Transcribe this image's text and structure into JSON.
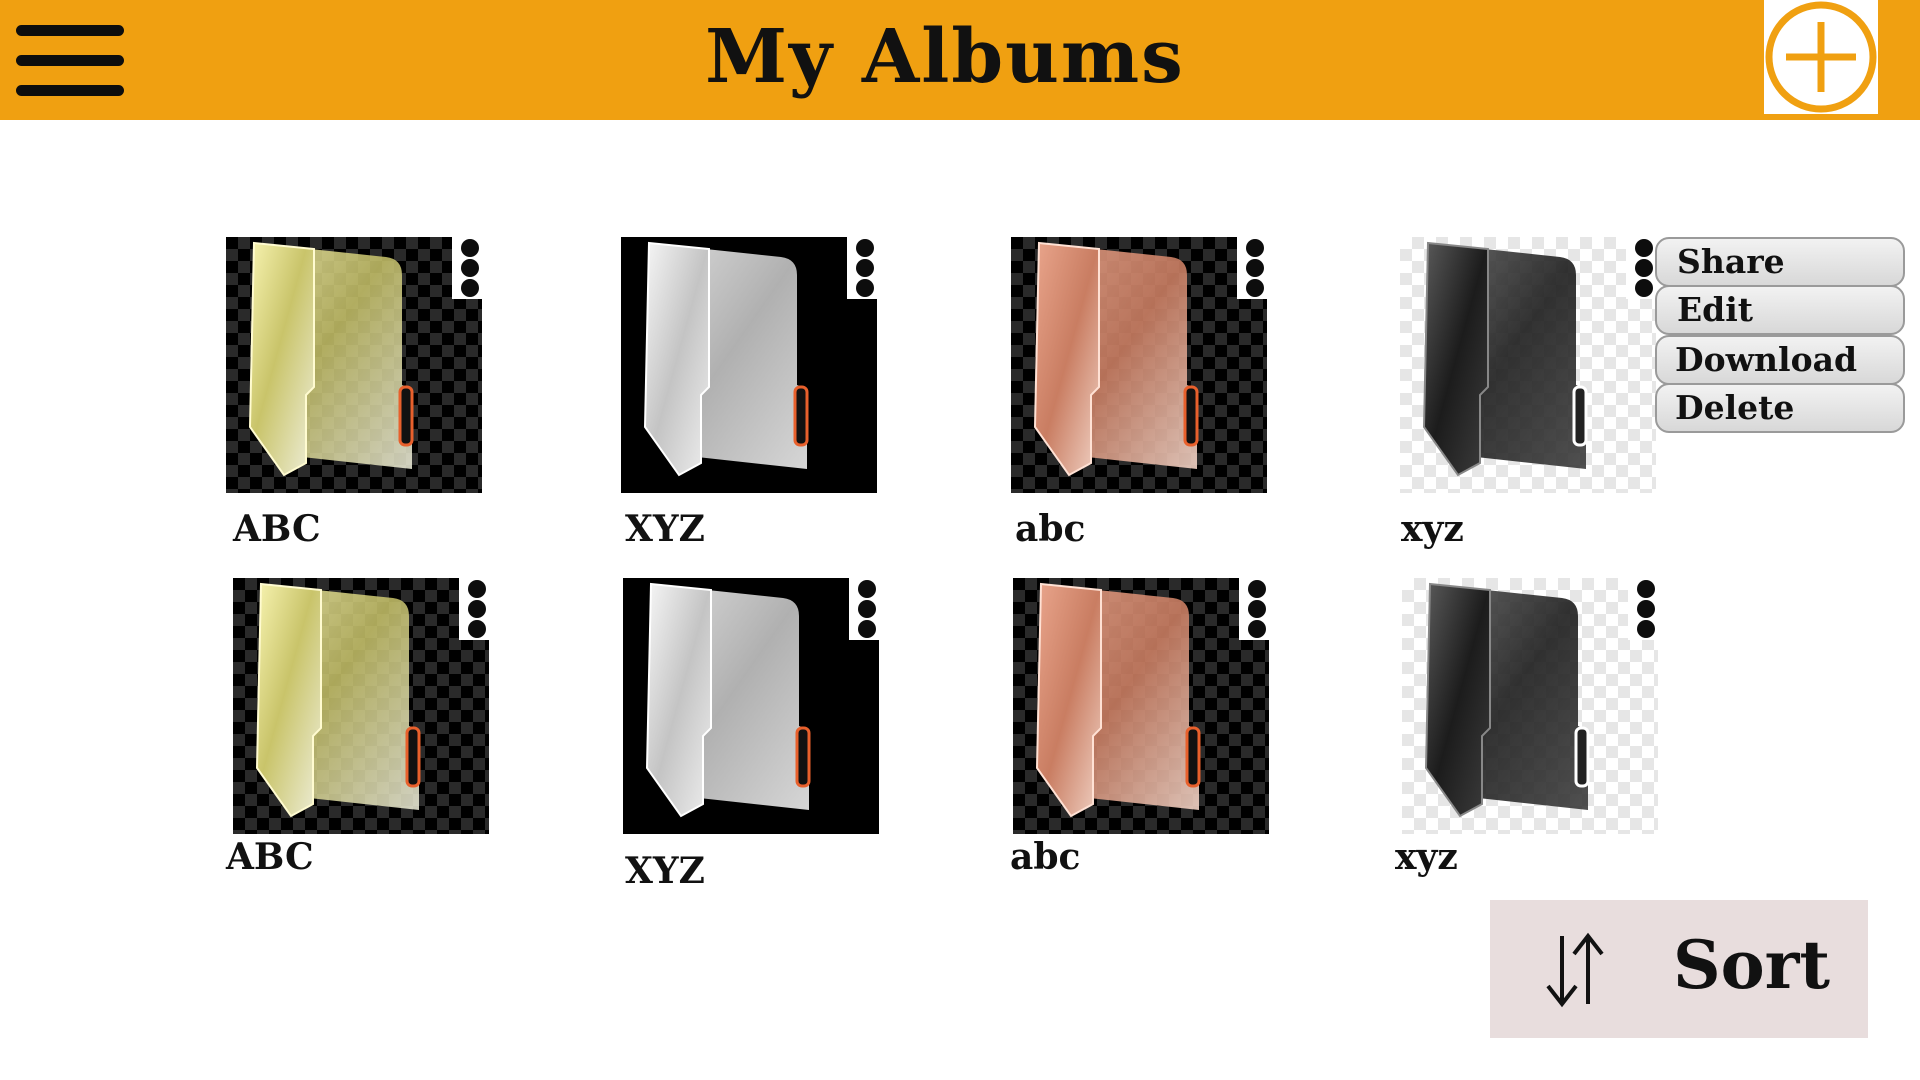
{
  "header": {
    "title": "My Albums",
    "background_color": "#f0a011",
    "menu_icon": "hamburger-menu-icon",
    "add_icon": "plus-circle-icon"
  },
  "albums": [
    {
      "label": "ABC",
      "folder_color": "yellow",
      "background": "checkerboard-dark"
    },
    {
      "label": "XYZ",
      "folder_color": "white",
      "background": "black"
    },
    {
      "label": "abc",
      "folder_color": "peach",
      "background": "checkerboard-dark"
    },
    {
      "label": "xyz",
      "folder_color": "black",
      "background": "checkerboard-light"
    },
    {
      "label": "ABC",
      "folder_color": "yellow",
      "background": "checkerboard-dark"
    },
    {
      "label": "XYZ",
      "folder_color": "white",
      "background": "black"
    },
    {
      "label": "abc",
      "folder_color": "peach",
      "background": "checkerboard-dark"
    },
    {
      "label": "xyz",
      "folder_color": "black",
      "background": "checkerboard-light"
    }
  ],
  "context_menu": {
    "items": [
      "Share",
      "Edit",
      "Download",
      "Delete"
    ]
  },
  "sort": {
    "label": "Sort",
    "icon": "sort-arrows-icon"
  }
}
